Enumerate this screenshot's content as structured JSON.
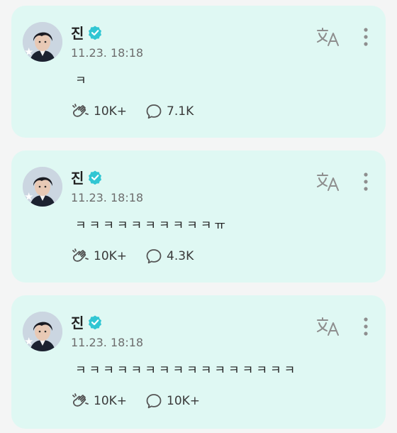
{
  "posts": [
    {
      "author": "진",
      "time": "11.23. 18:18",
      "text": "ㅋ",
      "likes": "10K+",
      "comments": "7.1K"
    },
    {
      "author": "진",
      "time": "11.23. 18:18",
      "text": "ㅋㅋㅋㅋㅋㅋㅋㅋㅋㅋㅠ",
      "likes": "10K+",
      "comments": "4.3K"
    },
    {
      "author": "진",
      "time": "11.23. 18:18",
      "text": "ㅋㅋㅋㅋㅋㅋㅋㅋㅋㅋㅋㅋㅋㅋㅋㅋ",
      "likes": "10K+",
      "comments": "10K+"
    }
  ],
  "icons": {
    "verified": "verified-badge-icon",
    "translate": "translate-icon",
    "more": "more-vertical-icon",
    "like": "applause-icon",
    "comment": "comment-icon"
  },
  "colors": {
    "card_background": "#dff8f3",
    "verified_badge": "#31c6d3",
    "icon_gray": "#8e8e8e"
  }
}
